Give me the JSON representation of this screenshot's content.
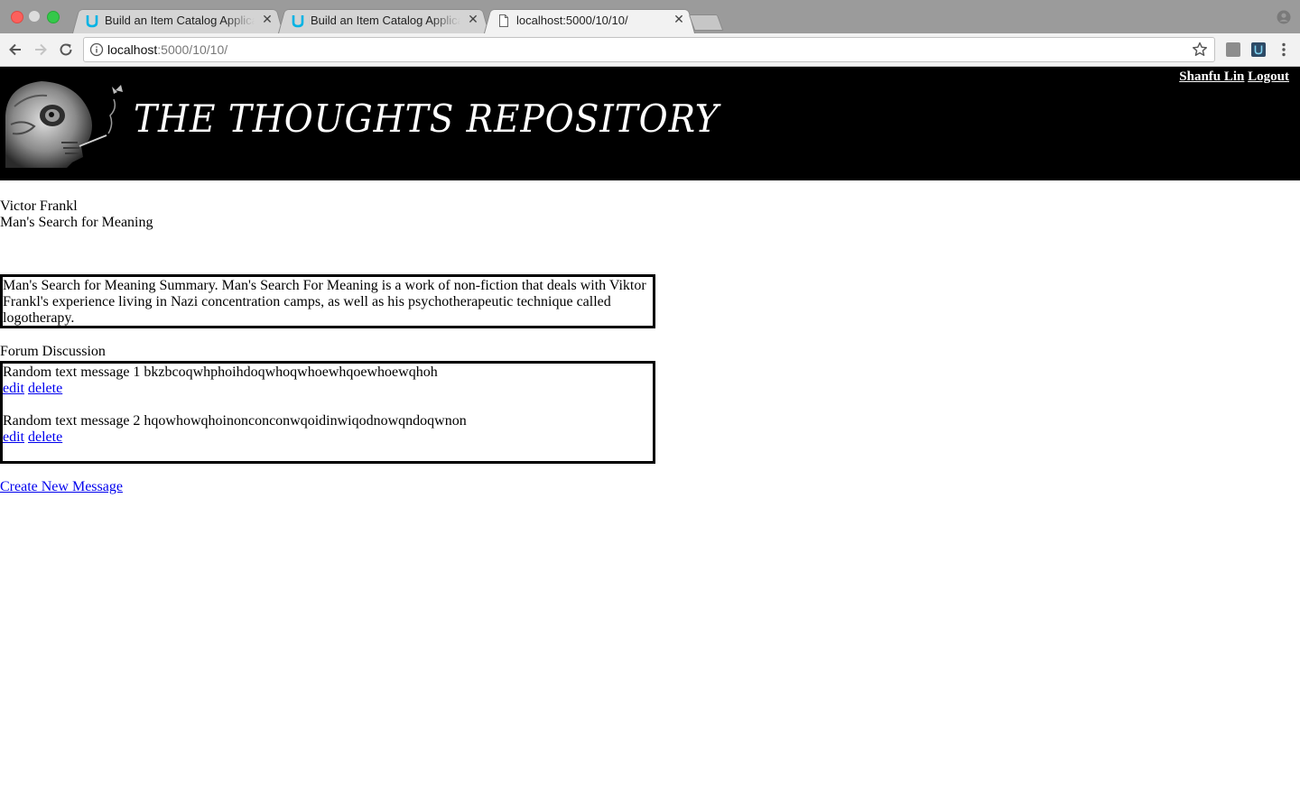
{
  "browser": {
    "tabs": [
      {
        "title": "Build an Item Catalog Applicati",
        "favicon": "udacity-icon",
        "active": false
      },
      {
        "title": "Build an Item Catalog Applicati",
        "favicon": "udacity-icon",
        "active": false
      },
      {
        "title": "localhost:5000/10/10/",
        "favicon": "document-icon",
        "active": true
      }
    ],
    "close_glyph": "✕",
    "address_bar": {
      "host": "localhost",
      "path": ":5000/10/10/"
    }
  },
  "header": {
    "site_title": "THE THOUGHTS REPOSITORY",
    "user_name": "Shanfu Lin",
    "logout_label": "Logout"
  },
  "book": {
    "author": "Victor Frankl",
    "title": "Man's Search for Meaning",
    "summary": "Man's Search for Meaning Summary. Man's Search For Meaning is a work of non-fiction that deals with Viktor Frankl's experience living in Nazi concentration camps, as well as his psychotherapeutic technique called logotherapy."
  },
  "forum": {
    "heading": "Forum Discussion",
    "messages": [
      {
        "text": "Random text message 1 bkzbcoqwhphoihdoqwhoqwhoewhqoewhoewqhoh",
        "edit_label": "edit",
        "delete_label": "delete"
      },
      {
        "text": "Random text message 2 hqowhowqhoinonconconwqoidinwiqodnowqndoqwnon",
        "edit_label": "edit",
        "delete_label": "delete"
      }
    ],
    "create_label": "Create New Message"
  },
  "colors": {
    "banner_bg": "#000000",
    "link": "#0000ee",
    "tabstrip": "#9b9b9b"
  }
}
